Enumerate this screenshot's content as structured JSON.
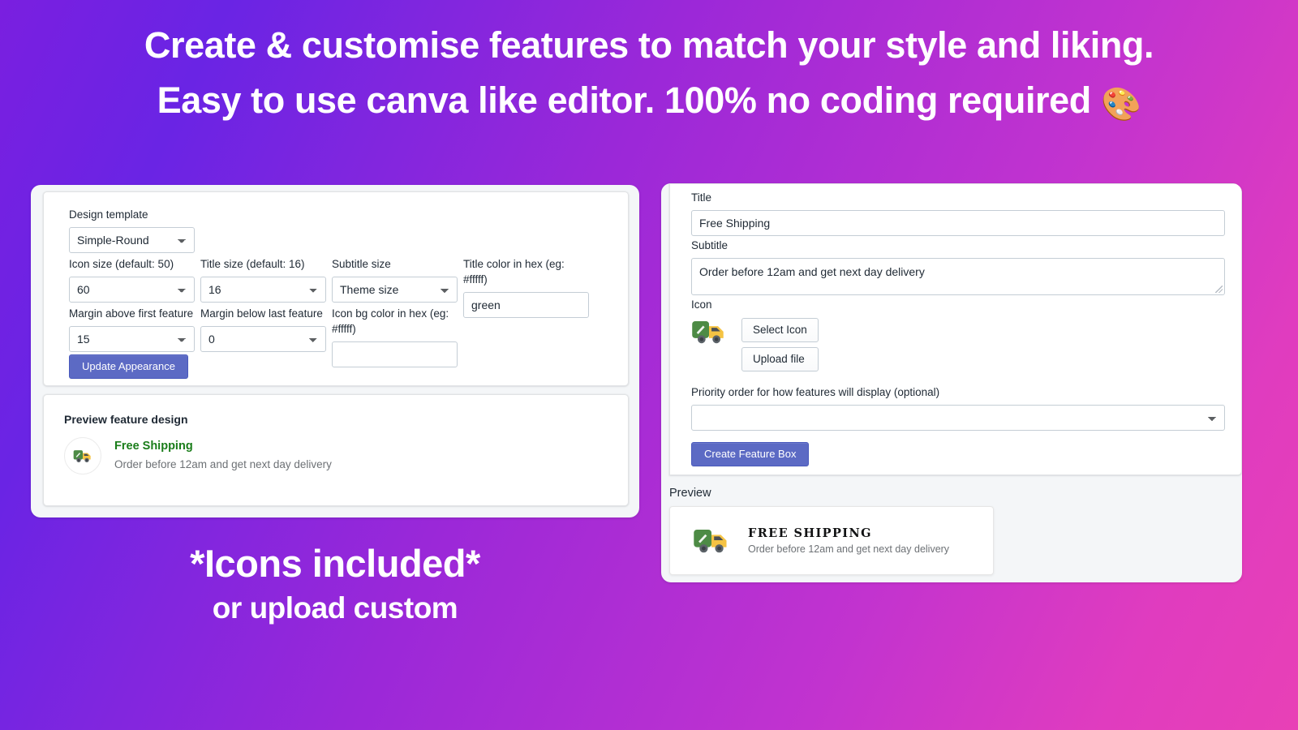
{
  "headline": {
    "line1": "Create & customise features to match your style and liking.",
    "line2_plain": "Easy to use canva like editor. ",
    "line2_bold": "100% no coding required ",
    "emoji": "🎨"
  },
  "caption": {
    "line1": "*Icons included*",
    "line2": "or upload custom"
  },
  "appearance": {
    "design_template": {
      "label": "Design template",
      "value": "Simple-Round"
    },
    "icon_size": {
      "label": "Icon size (default: 50)",
      "value": "60"
    },
    "title_size": {
      "label": "Title size (default: 16)",
      "value": "16"
    },
    "subtitle_size": {
      "label": "Subtitle size",
      "value": "Theme size"
    },
    "title_color": {
      "label": "Title color in hex (eg: #fffff)",
      "value": "green"
    },
    "margin_above": {
      "label": "Margin above first feature",
      "value": "15"
    },
    "margin_below": {
      "label": "Margin below last feature",
      "value": "0"
    },
    "icon_bg_color": {
      "label": "Icon bg color in hex (eg: #fffff)",
      "value": ""
    },
    "update_button": "Update Appearance"
  },
  "left_preview": {
    "heading": "Preview feature design",
    "feature_title": "Free Shipping",
    "feature_subtitle": "Order before 12am and get next day delivery",
    "icon": "delivery-truck-icon"
  },
  "feature_form": {
    "title": {
      "label": "Title",
      "value": "Free Shipping"
    },
    "subtitle": {
      "label": "Subtitle",
      "value": "Order before 12am and get next day delivery"
    },
    "icon": {
      "label": "Icon",
      "select_button": "Select Icon",
      "upload_button": "Upload file",
      "icon": "delivery-truck-icon"
    },
    "priority": {
      "label": "Priority order for how features will display (optional)",
      "value": ""
    },
    "submit_button": "Create Feature Box"
  },
  "right_preview": {
    "heading": "Preview",
    "feature_title": "FREE SHIPPING",
    "feature_subtitle": "Order before 12am and get next day delivery",
    "icon": "delivery-truck-icon"
  },
  "colors": {
    "gradient_start": "#7a1fe0",
    "gradient_end": "#e840b6",
    "primary_button": "#5c6ac4",
    "preview_title_green": "#1a7d1a",
    "panel_bg": "#f4f6f8"
  }
}
